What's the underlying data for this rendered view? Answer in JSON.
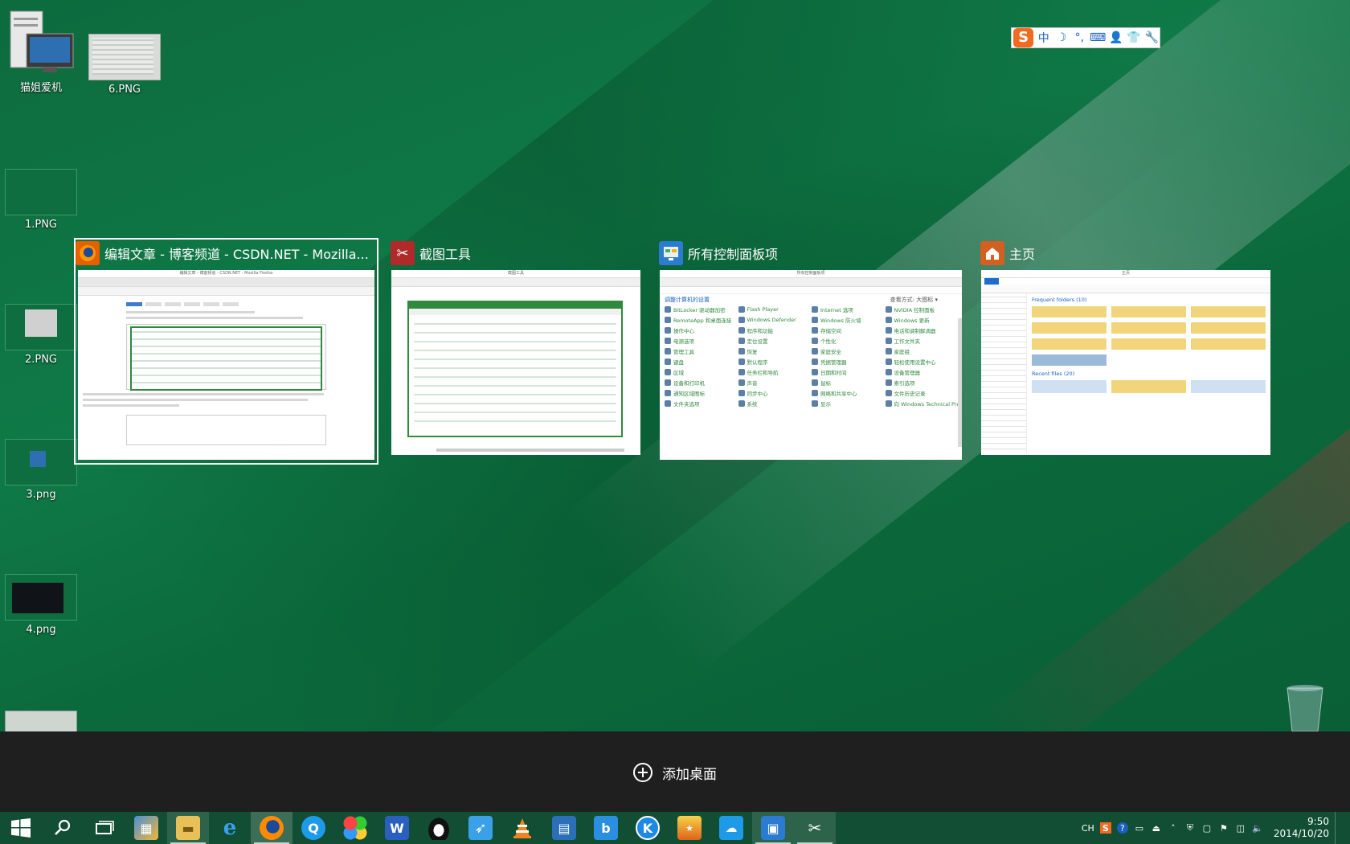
{
  "desktop": {
    "icons": [
      {
        "id": "computer",
        "label": "猫姐爱机"
      },
      {
        "id": "img6",
        "label": "6.PNG"
      },
      {
        "id": "img1",
        "label": "1.PNG"
      },
      {
        "id": "img2",
        "label": "2.PNG"
      },
      {
        "id": "img3",
        "label": "3.png"
      },
      {
        "id": "img4",
        "label": "4.png"
      }
    ]
  },
  "ime": {
    "items": [
      "中",
      "☽",
      "°,",
      "⌨",
      "👤",
      "👕",
      "🔧"
    ]
  },
  "task_view": {
    "windows": [
      {
        "title": "编辑文章 - 博客频道 - CSDN.NET - Mozilla...",
        "app": "firefox",
        "selected": true
      },
      {
        "title": "截图工具",
        "app": "snipping-tool",
        "selected": false
      },
      {
        "title": "所有控制面板项",
        "app": "control-panel",
        "selected": false
      },
      {
        "title": "主页",
        "app": "file-explorer",
        "selected": false
      }
    ],
    "previews": {
      "firefox_tabs": [
        "编辑文章 - 博客频道 - CSDN.NET - Mozilla Firefox"
      ],
      "snip_title": "截图工具",
      "cp_title": "所有控制面板项",
      "cp_heading": "调整计算机的设置",
      "cp_view": "查看方式:  大图标 ▾",
      "cp_items": [
        "BitLocker 驱动器加密",
        "Flash Player",
        "Internet 选项",
        "NVIDIA 控制面板",
        "RemoteApp 和桌面连接",
        "Windows Defender",
        "Windows 防火墙",
        "Windows 更新",
        "操作中心",
        "程序和功能",
        "存储空间",
        "电话和调制解调器",
        "电源选项",
        "定位设置",
        "个性化",
        "工作文件夹",
        "管理工具",
        "恢复",
        "家庭安全",
        "家庭组",
        "键盘",
        "默认程序",
        "凭据管理器",
        "轻松使用设置中心",
        "区域",
        "任务栏和导航",
        "日期和时间",
        "设备管理器",
        "设备和打印机",
        "声音",
        "鼠标",
        "索引选项",
        "通知区域图标",
        "同步中心",
        "网络和共享中心",
        "文件历史记录",
        "文件夹选项",
        "系统",
        "显示",
        "向 Windows Technical Preview 添加功能"
      ],
      "explorer_title": "主页",
      "explorer_frequent": "Frequent folders (10)",
      "explorer_recent": "Recent files (20)"
    }
  },
  "add_desktop": {
    "label": "添加桌面"
  },
  "taskbar": {
    "apps": [
      {
        "id": "start",
        "icon": "windows-logo-icon"
      },
      {
        "id": "search",
        "icon": "search-icon"
      },
      {
        "id": "task-view",
        "icon": "task-view-icon"
      },
      {
        "id": "library",
        "icon": "library-icon"
      },
      {
        "id": "explorer",
        "icon": "folder-icon"
      },
      {
        "id": "ie",
        "icon": "ie-icon"
      },
      {
        "id": "firefox",
        "icon": "firefox-icon"
      },
      {
        "id": "app-q",
        "icon": "q-browser-icon"
      },
      {
        "id": "clover",
        "icon": "clover-icon"
      },
      {
        "id": "wps",
        "icon": "w-icon"
      },
      {
        "id": "qq",
        "icon": "penguin-icon"
      },
      {
        "id": "bird",
        "icon": "bird-icon"
      },
      {
        "id": "vlc",
        "icon": "vlc-cone-icon"
      },
      {
        "id": "film",
        "icon": "film-icon"
      },
      {
        "id": "app-b",
        "icon": "b-icon"
      },
      {
        "id": "app-k",
        "icon": "k-icon"
      },
      {
        "id": "game",
        "icon": "game-icon"
      },
      {
        "id": "cloud",
        "icon": "cloud-icon"
      },
      {
        "id": "control-panel",
        "icon": "control-panel-icon"
      },
      {
        "id": "snipping",
        "icon": "scissors-icon"
      }
    ],
    "tray": {
      "lang": "CH",
      "time": "9:50",
      "date": "2014/10/20"
    }
  }
}
